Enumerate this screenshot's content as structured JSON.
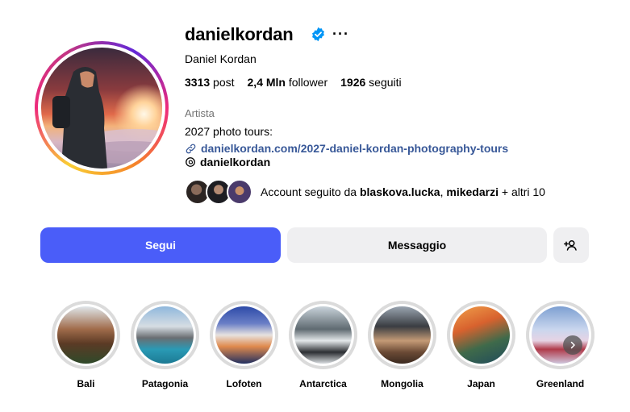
{
  "profile": {
    "username": "danielkordan",
    "full_name": "Daniel Kordan",
    "category": "Artista",
    "bio": "2027 photo tours:",
    "link": "danielkordan.com/2027-daniel-kordan-photography-tours",
    "threads_handle": "danielkordan",
    "more_label": "···"
  },
  "stats": {
    "posts_count": "3313",
    "posts_label": "post",
    "followers_count": "2,4 Mln",
    "followers_label": "follower",
    "following_count": "1926",
    "following_label": "seguiti"
  },
  "followed_by": {
    "prefix": "Account seguito da ",
    "user1": "blaskova.lucka",
    "separator": ", ",
    "user2": "mikedarzi",
    "suffix": " + altri 10"
  },
  "buttons": {
    "follow": "Segui",
    "message": "Messaggio"
  },
  "highlights": [
    {
      "label": "Bali"
    },
    {
      "label": "Patagonia"
    },
    {
      "label": "Lofoten"
    },
    {
      "label": "Antarctica"
    },
    {
      "label": "Mongolia"
    },
    {
      "label": "Japan"
    },
    {
      "label": "Greenland"
    }
  ],
  "colors": {
    "accent": "#4a5df9",
    "verified": "#0095f6",
    "link": "#385898"
  },
  "icons": {
    "verified": "verified-badge-icon",
    "link": "link-icon",
    "threads": "threads-icon",
    "add_user": "add-user-icon",
    "next": "chevron-right-icon"
  }
}
